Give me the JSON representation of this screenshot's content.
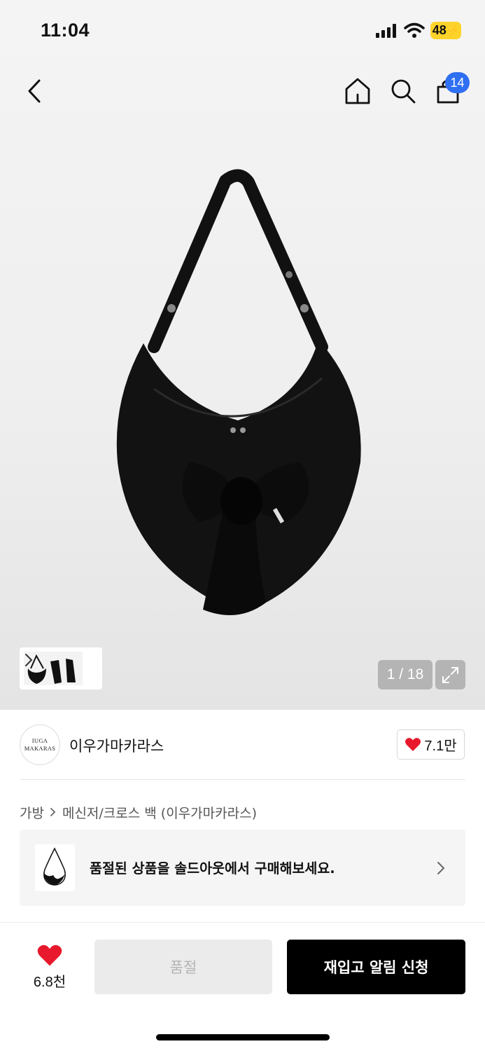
{
  "status_bar": {
    "time": "11:04",
    "battery": "48"
  },
  "header": {
    "cart_count": "14"
  },
  "gallery": {
    "page_indicator": "1 / 18",
    "icons": {
      "back": "chevron-left-icon",
      "home": "home-icon",
      "search": "search-icon",
      "cart": "shopping-bag-icon",
      "expand": "expand-icon"
    }
  },
  "brand": {
    "logo_line1": "IUGA",
    "logo_line2": "MAKARAS",
    "name": "이우가마카라스",
    "likes": "7.1만"
  },
  "breadcrumb": {
    "category": "가방",
    "subcategory": "메신저/크로스 백 (이우가마카라스)"
  },
  "soldout_banner": {
    "text": "품절된 상품을 솔드아웃에서 구매해보세요."
  },
  "bottom_bar": {
    "wish_count": "6.8천",
    "soldout_label": "품절",
    "restock_label": "재입고 알림 신청"
  },
  "colors": {
    "accent_badge": "#2f6ff1",
    "heart": "#e8192c",
    "battery": "#ffd32a",
    "primary_button": "#000000"
  }
}
